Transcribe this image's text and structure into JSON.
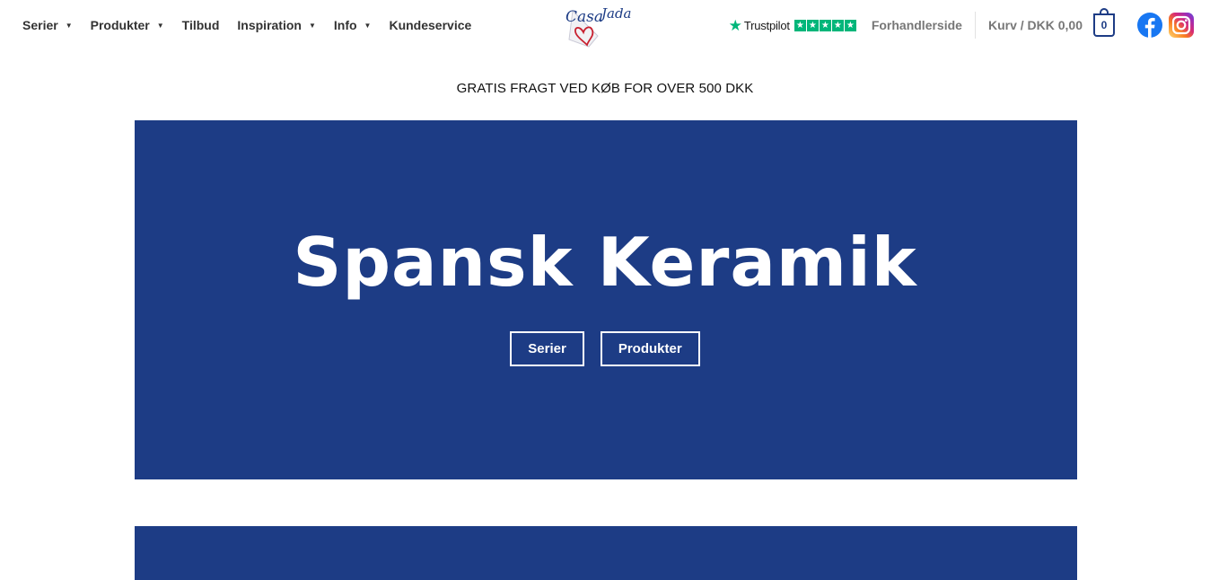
{
  "nav": {
    "left": [
      {
        "label": "Serier",
        "has_dropdown": true
      },
      {
        "label": "Produkter",
        "has_dropdown": true
      },
      {
        "label": "Tilbud",
        "has_dropdown": false
      },
      {
        "label": "Inspiration",
        "has_dropdown": true
      },
      {
        "label": "Info",
        "has_dropdown": true
      },
      {
        "label": "Kundeservice",
        "has_dropdown": false
      }
    ],
    "caret": "▼",
    "logo": {
      "text": "Casa Jada",
      "icon": "heart-logo-icon"
    },
    "trustpilot": {
      "label": "Trustpilot",
      "stars": 5,
      "star_glyph": "★"
    },
    "dealer_label": "Forhandlerside",
    "cart_label": "Kurv / DKK 0,00",
    "cart_count": "0"
  },
  "banner_text": "GRATIS FRAGT VED KØB FOR OVER 500 DKK",
  "hero": {
    "title": "Spansk Keramik",
    "buttons": [
      "Serier",
      "Produkter"
    ]
  },
  "colors": {
    "brand_blue": "#1d3c85",
    "trustpilot_green": "#00b67a",
    "facebook_blue": "#1877f2",
    "text_dark": "#333333",
    "text_muted": "#777777"
  },
  "icons": [
    "trustpilot-star-icon",
    "cart-icon",
    "facebook-icon",
    "instagram-icon",
    "caret-down-icon"
  ]
}
